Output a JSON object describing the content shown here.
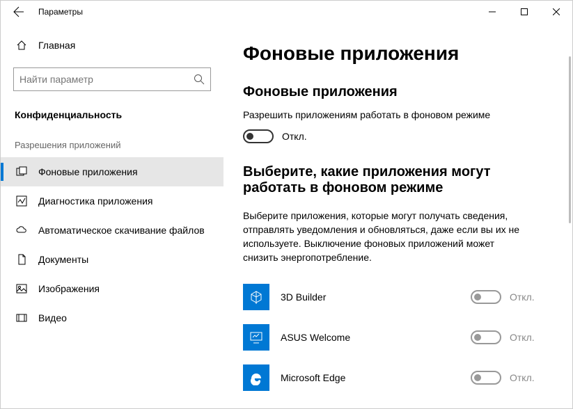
{
  "window": {
    "title": "Параметры"
  },
  "sidebar": {
    "home_label": "Главная",
    "search_placeholder": "Найти параметр",
    "section": "Конфиденциальность",
    "group": "Разрешения приложений",
    "items": [
      {
        "label": "Фоновые приложения"
      },
      {
        "label": "Диагностика приложения"
      },
      {
        "label": "Автоматическое скачивание файлов"
      },
      {
        "label": "Документы"
      },
      {
        "label": "Изображения"
      },
      {
        "label": "Видео"
      }
    ]
  },
  "content": {
    "title": "Фоновые приложения",
    "sub1": "Фоновые приложения",
    "allow_desc": "Разрешить приложениям работать в фоновом режиме",
    "master_state": "Откл.",
    "sub2": "Выберите, какие приложения могут работать в фоновом режиме",
    "desc2": "Выберите приложения, которые могут получать сведения, отправлять уведомления и обновляться, даже если вы их не используете. Выключение фоновых приложений может снизить энергопотребление.",
    "apps": [
      {
        "name": "3D Builder",
        "state": "Откл."
      },
      {
        "name": "ASUS Welcome",
        "state": "Откл."
      },
      {
        "name": "Microsoft Edge",
        "state": "Откл."
      }
    ]
  }
}
